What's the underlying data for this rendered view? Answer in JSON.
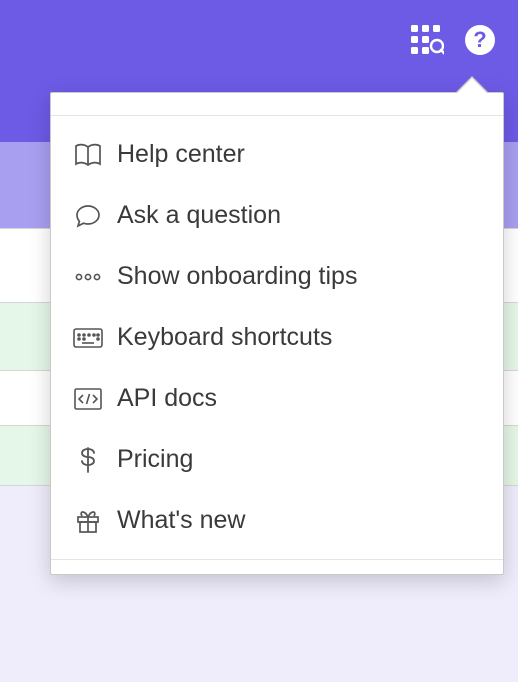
{
  "colors": {
    "brand_primary": "#6d5be6",
    "brand_light": "#a89ff0",
    "row_highlight": "#e5f7e8",
    "panel_bg": "#efecfb"
  },
  "header": {
    "apps_icon": "apps-grid-icon",
    "help_icon": "help-icon"
  },
  "help_menu": {
    "items": [
      {
        "icon": "book-icon",
        "label": "Help center"
      },
      {
        "icon": "chat-icon",
        "label": "Ask a question"
      },
      {
        "icon": "dots-icon",
        "label": "Show onboarding tips"
      },
      {
        "icon": "keyboard-icon",
        "label": "Keyboard shortcuts"
      },
      {
        "icon": "code-icon",
        "label": "API docs"
      },
      {
        "icon": "dollar-icon",
        "label": "Pricing"
      },
      {
        "icon": "gift-icon",
        "label": "What's new"
      }
    ]
  }
}
